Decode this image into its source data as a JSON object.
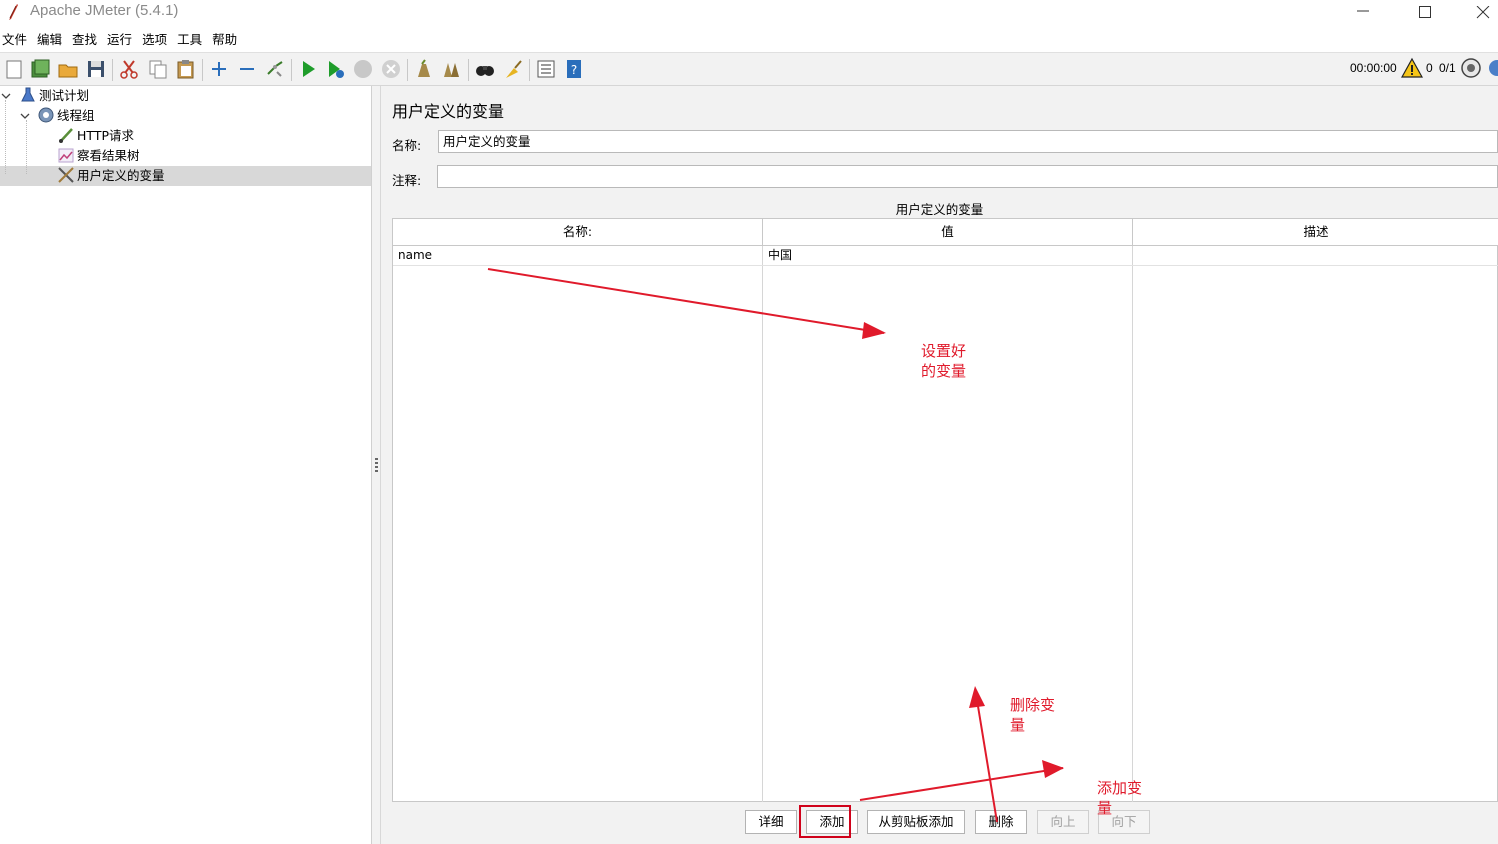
{
  "window": {
    "title": "Apache JMeter (5.4.1)"
  },
  "menu": [
    "文件",
    "编辑",
    "查找",
    "运行",
    "选项",
    "工具",
    "帮助"
  ],
  "toolbar": {
    "icons": [
      "new-icon",
      "templates-icon",
      "open-icon",
      "save-icon",
      "cut-icon",
      "copy-icon",
      "paste-icon",
      "expand-icon",
      "collapse-icon",
      "toggle-icon",
      "start-icon",
      "start-no-pause-icon",
      "stop-icon",
      "shutdown-icon",
      "clear-icon",
      "clear-all-icon",
      "search-icon",
      "reset-search-icon",
      "function-helper-icon",
      "help-icon"
    ],
    "timer": "00:00:00",
    "warning_count": "0",
    "threads": "0/1"
  },
  "tree": {
    "items": [
      {
        "label": "测试计划",
        "icon": "test-plan-icon"
      },
      {
        "label": "线程组",
        "icon": "thread-group-icon"
      },
      {
        "label": "HTTP请求",
        "icon": "http-sampler-icon"
      },
      {
        "label": "察看结果树",
        "icon": "results-tree-icon"
      },
      {
        "label": "用户定义的变量",
        "icon": "user-variables-icon"
      }
    ],
    "selected": "用户定义的变量"
  },
  "panel": {
    "title": "用户定义的变量",
    "name_label": "名称:",
    "name_value": "用户定义的变量",
    "comment_label": "注释:",
    "comment_value": "",
    "table_caption": "用户定义的变量",
    "columns": [
      "名称:",
      "值",
      "描述"
    ],
    "rows": [
      {
        "name": "name",
        "value": "中国",
        "desc": ""
      }
    ],
    "buttons": {
      "detail": "详细",
      "add": "添加",
      "add_clipboard": "从剪贴板添加",
      "delete": "删除",
      "up": "向上",
      "down": "向下"
    }
  },
  "annotations": {
    "set_var_line1": "设置好",
    "set_var_line2": "的变量",
    "delete_line1": "删除变",
    "delete_line2": "量",
    "add_line1": "添加变",
    "add_line2": "量",
    "color": "#e01a2b"
  }
}
